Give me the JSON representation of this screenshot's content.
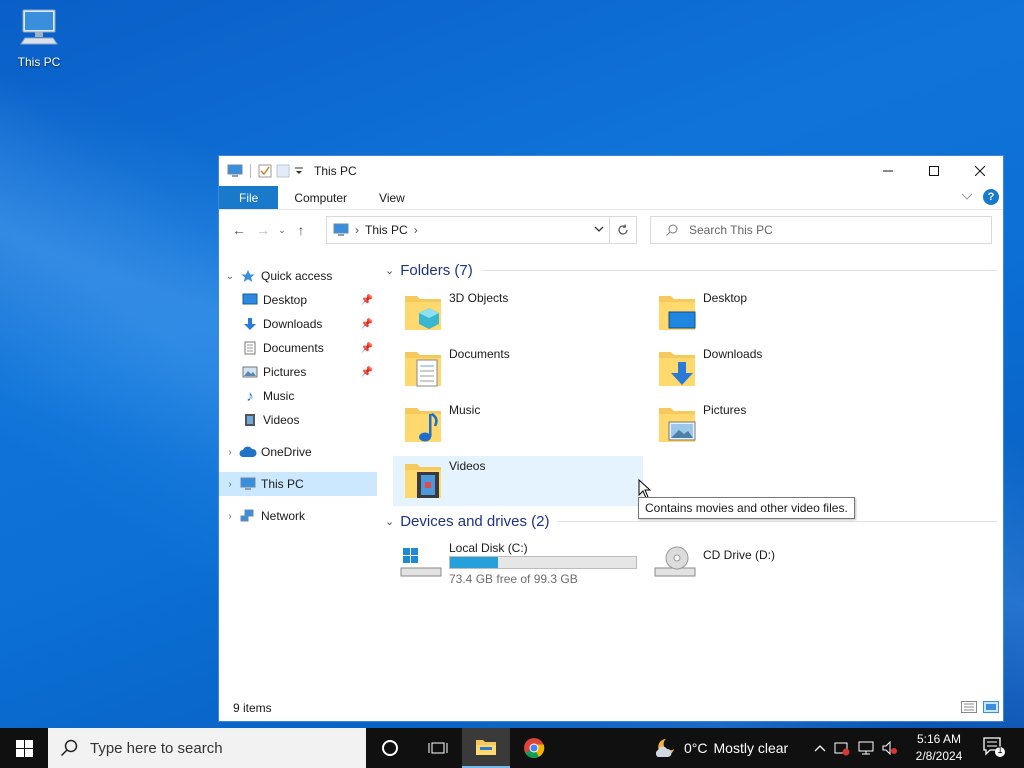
{
  "desktop": {
    "icon_label": "This PC"
  },
  "window": {
    "title": "This PC",
    "ribbon_tabs": [
      "File",
      "Computer",
      "View"
    ],
    "address": {
      "crumb": "This PC"
    },
    "search": {
      "placeholder": "Search This PC"
    },
    "controls": {
      "minimize": "minimize",
      "maximize": "maximize",
      "close": "close"
    }
  },
  "navpane": {
    "quick_access": "Quick access",
    "quick_items": [
      {
        "label": "Desktop",
        "pinned": true
      },
      {
        "label": "Downloads",
        "pinned": true
      },
      {
        "label": "Documents",
        "pinned": true
      },
      {
        "label": "Pictures",
        "pinned": true
      },
      {
        "label": "Music",
        "pinned": false
      },
      {
        "label": "Videos",
        "pinned": false
      }
    ],
    "onedrive": "OneDrive",
    "thispc": "This PC",
    "network": "Network"
  },
  "content": {
    "folders_header": "Folders (7)",
    "folders": [
      "3D Objects",
      "Desktop",
      "Documents",
      "Downloads",
      "Music",
      "Pictures",
      "Videos"
    ],
    "devices_header": "Devices and drives (2)",
    "drives": [
      {
        "name": "Local Disk (C:)",
        "free_text": "73.4 GB free of 99.3 GB",
        "used_fraction": 0.26
      },
      {
        "name": "CD Drive (D:)"
      }
    ],
    "tooltip": "Contains movies and other video files."
  },
  "status": {
    "items": "9 items"
  },
  "taskbar": {
    "search_placeholder": "Type here to search",
    "weather_temp": "0°C",
    "weather_text": "Mostly clear",
    "time": "5:16 AM",
    "date": "2/8/2024",
    "notification_count": "1"
  },
  "colors": {
    "accent": "#1979ca",
    "selection": "#cce8ff",
    "hover": "#e5f3ff",
    "drive_fill": "#26a0da"
  }
}
